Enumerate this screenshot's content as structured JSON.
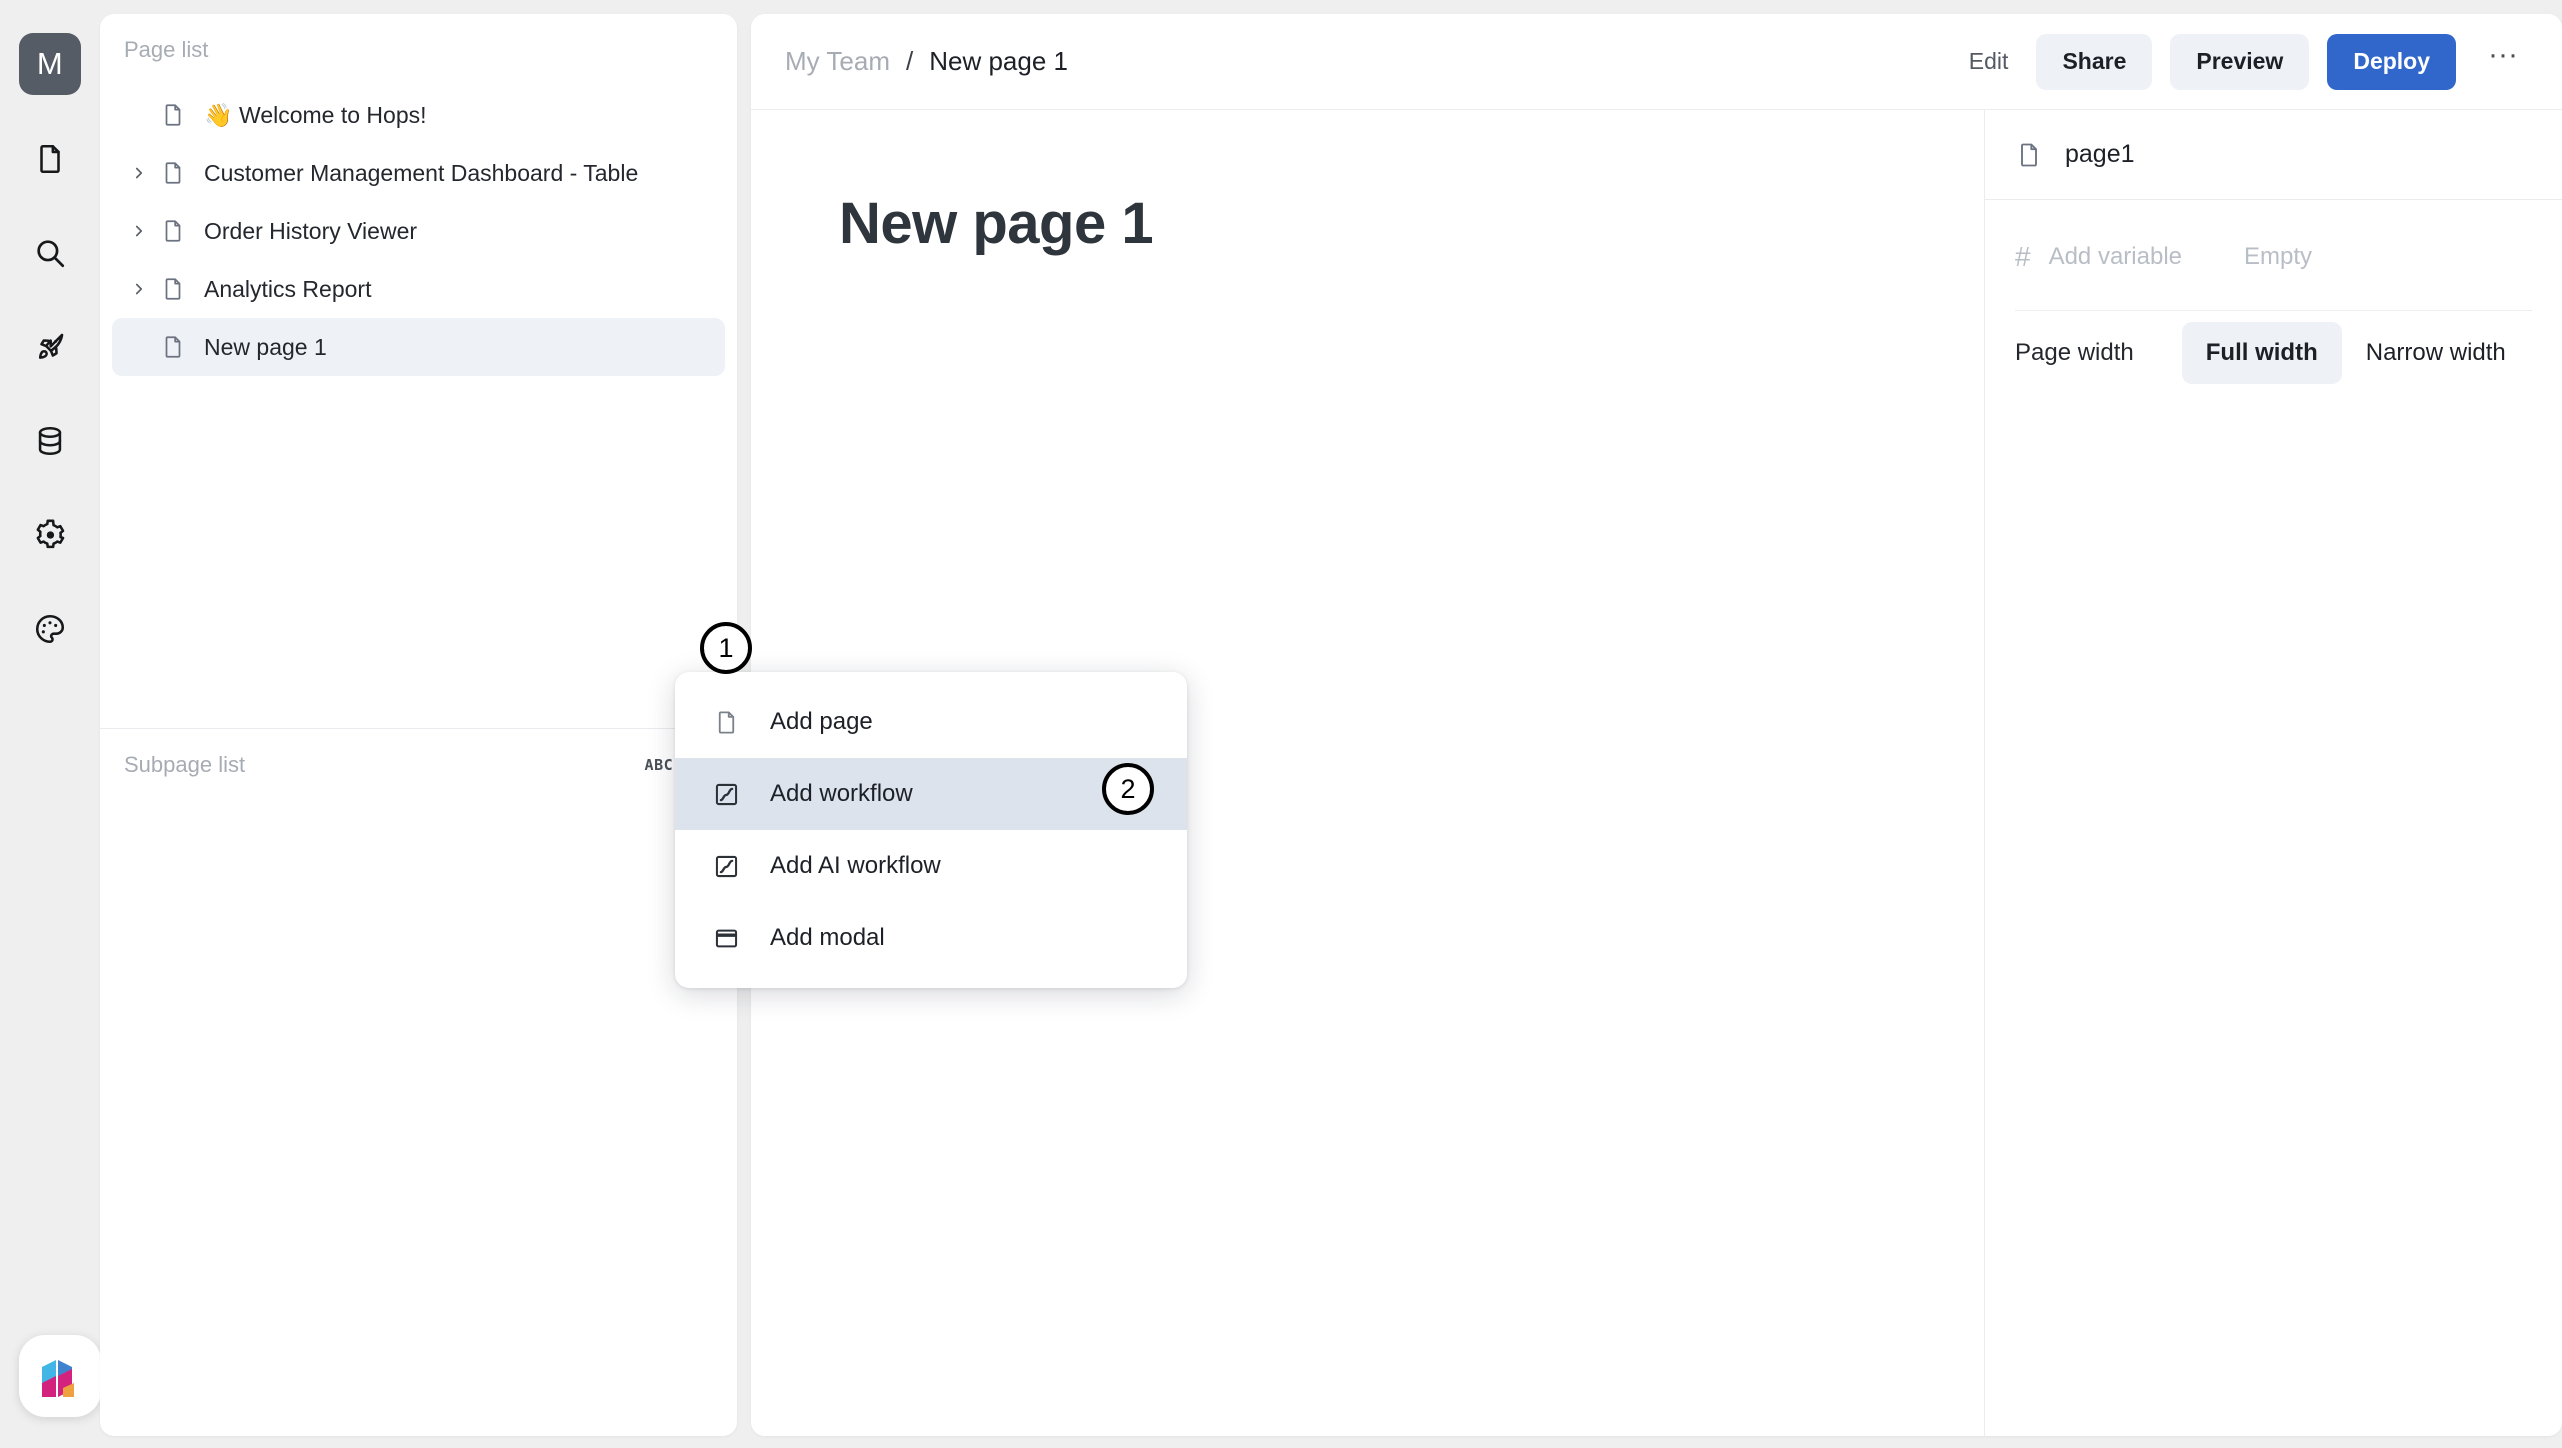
{
  "rail": {
    "avatar_label": "M",
    "items": [
      {
        "name": "document-icon",
        "icon": "document"
      },
      {
        "name": "search-icon",
        "icon": "search"
      },
      {
        "name": "rocket-icon",
        "icon": "rocket"
      },
      {
        "name": "database-icon",
        "icon": "database"
      },
      {
        "name": "gear-icon",
        "icon": "gear"
      },
      {
        "name": "palette-icon",
        "icon": "palette"
      }
    ]
  },
  "sidebar": {
    "page_list_title": "Page list",
    "pages": [
      {
        "label": "👋 Welcome to Hops!",
        "expandable": false,
        "selected": false
      },
      {
        "label": "Customer Management Dashboard - Table",
        "expandable": true,
        "selected": false
      },
      {
        "label": "Order History Viewer",
        "expandable": true,
        "selected": false
      },
      {
        "label": "Analytics Report",
        "expandable": true,
        "selected": false
      },
      {
        "label": "New page 1",
        "expandable": false,
        "selected": true
      }
    ],
    "subpage_list_title": "Subpage list",
    "abc_label": "ABC",
    "add_label": "+"
  },
  "menu": {
    "items": [
      {
        "label": "Add page",
        "icon": "document",
        "active": false
      },
      {
        "label": "Add workflow",
        "icon": "workflow",
        "active": true
      },
      {
        "label": "Add AI workflow",
        "icon": "workflow",
        "active": false
      },
      {
        "label": "Add modal",
        "icon": "modal",
        "active": false
      }
    ]
  },
  "annotations": [
    {
      "number": "1"
    },
    {
      "number": "2"
    }
  ],
  "topbar": {
    "breadcrumb_team": "My Team",
    "breadcrumb_sep": "/",
    "breadcrumb_page": "New page 1",
    "edit_label": "Edit",
    "share_label": "Share",
    "preview_label": "Preview",
    "deploy_label": "Deploy",
    "more_label": "···"
  },
  "canvas": {
    "title": "New page 1"
  },
  "inspector": {
    "page_name": "page1",
    "hash_symbol": "#",
    "add_variable_label": "Add variable",
    "empty_label": "Empty",
    "page_width_label": "Page width",
    "full_width_label": "Full width",
    "narrow_width_label": "Narrow width"
  },
  "colors": {
    "accent": "#3167ca",
    "selected_row": "#eef1f6",
    "menu_active": "#dce3ec",
    "avatar_bg": "#555c66"
  }
}
